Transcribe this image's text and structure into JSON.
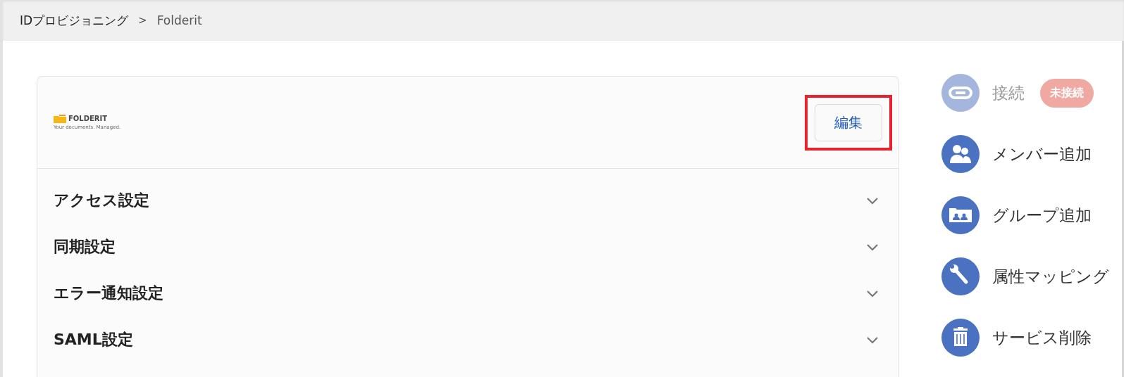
{
  "breadcrumb": [
    {
      "label": "IDプロビジョニング",
      "current": false
    },
    {
      "label": "Folderit",
      "current": true
    }
  ],
  "breadcrumb_separator": ">",
  "service": {
    "logo_name": "FOLDERIT",
    "logo_tagline": "Your documents. Managed.",
    "edit_button": {
      "label": "編集",
      "highlighted": true
    }
  },
  "sections": [
    {
      "title": "アクセス設定",
      "expanded": false
    },
    {
      "title": "同期設定",
      "expanded": false
    },
    {
      "title": "エラー通知設定",
      "expanded": false
    },
    {
      "title": "SAML設定",
      "expanded": false
    }
  ],
  "actions": [
    {
      "kind": "link",
      "label": "接続",
      "disabled": true,
      "badge": "未接続"
    },
    {
      "kind": "members",
      "label": "メンバー追加",
      "disabled": false
    },
    {
      "kind": "group",
      "label": "グループ追加",
      "disabled": false
    },
    {
      "kind": "wrench",
      "label": "属性マッピング",
      "disabled": false
    },
    {
      "kind": "trash",
      "label": "サービス削除",
      "disabled": false
    }
  ]
}
